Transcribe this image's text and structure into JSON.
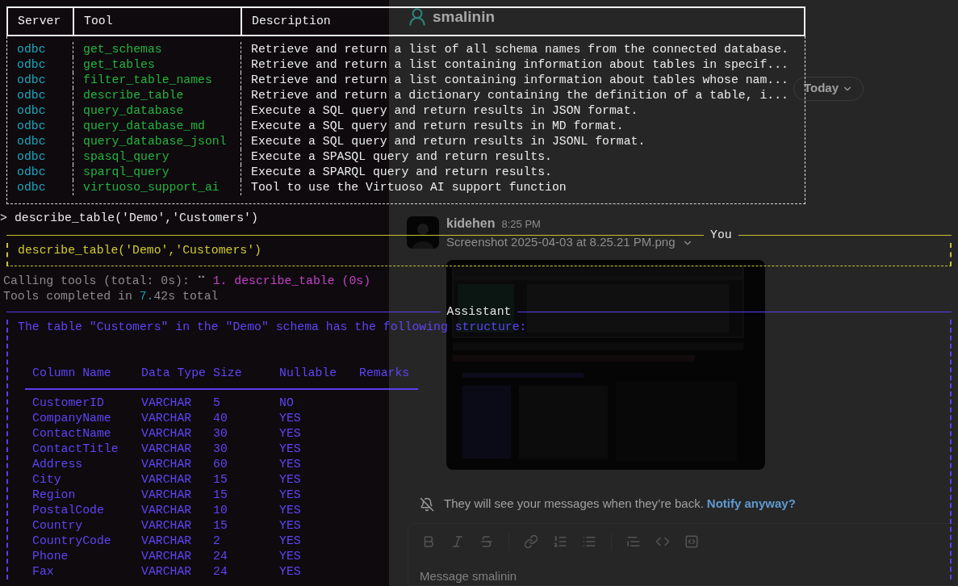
{
  "terminal": {
    "tools_table": {
      "columns": [
        "Server",
        "Tool",
        "Description"
      ],
      "rows": [
        {
          "server": "odbc",
          "tool": "get_schemas",
          "description": "Retrieve and return a list of all schema names from the connected database."
        },
        {
          "server": "odbc",
          "tool": "get_tables",
          "description": "Retrieve and return a list containing information about tables in specif..."
        },
        {
          "server": "odbc",
          "tool": "filter_table_names",
          "description": "Retrieve and return a list containing information about tables whose nam..."
        },
        {
          "server": "odbc",
          "tool": "describe_table",
          "description": "Retrieve and return a dictionary containing the definition of a table, i..."
        },
        {
          "server": "odbc",
          "tool": "query_database",
          "description": "Execute a SQL query and return results in JSON format."
        },
        {
          "server": "odbc",
          "tool": "query_database_md",
          "description": "Execute a SQL query and return results in MD format."
        },
        {
          "server": "odbc",
          "tool": "query_database_jsonl",
          "description": "Execute a SQL query and return results in JSONL format."
        },
        {
          "server": "odbc",
          "tool": "spasql_query",
          "description": "Execute a SPASQL query and return results."
        },
        {
          "server": "odbc",
          "tool": "sparql_query",
          "description": "Execute a SPARQL query and return results."
        },
        {
          "server": "odbc",
          "tool": "virtuoso_support_ai",
          "description": "Tool to use the Virtuoso AI support function"
        }
      ]
    },
    "prompt": {
      "marker": ">",
      "command": "describe_table('Demo','Customers')"
    },
    "user_message": {
      "label": "You",
      "text": "describe_table('Demo','Customers')"
    },
    "status_lines": [
      [
        {
          "text": "Calling tools (total: 0s): ",
          "kind": "plain"
        },
        {
          "text": "⠉ ",
          "kind": "spinner"
        },
        {
          "text": "1. describe_table (0s)",
          "kind": "call"
        }
      ],
      [
        {
          "text": "Tools completed in ",
          "kind": "plain"
        },
        {
          "text": "7.",
          "kind": "accent"
        },
        {
          "text": "42s total",
          "kind": "plain"
        }
      ]
    ],
    "assistant_message": {
      "label": "Assistant",
      "intro": "The table \"Customers\" in the \"Demo\" schema has the following structure:",
      "table": {
        "columns": [
          "Column Name",
          "Data Type",
          "Size",
          "Nullable",
          "Remarks"
        ],
        "rows": [
          [
            "CustomerID",
            "VARCHAR",
            "5",
            "NO"
          ],
          [
            "CompanyName",
            "VARCHAR",
            "40",
            "YES"
          ],
          [
            "ContactName",
            "VARCHAR",
            "30",
            "YES"
          ],
          [
            "ContactTitle",
            "VARCHAR",
            "30",
            "YES"
          ],
          [
            "Address",
            "VARCHAR",
            "60",
            "YES"
          ],
          [
            "City",
            "VARCHAR",
            "15",
            "YES"
          ],
          [
            "Region",
            "VARCHAR",
            "15",
            "YES"
          ],
          [
            "PostalCode",
            "VARCHAR",
            "10",
            "YES"
          ],
          [
            "Country",
            "VARCHAR",
            "15",
            "YES"
          ],
          [
            "CountryCode",
            "VARCHAR",
            "2",
            "YES"
          ],
          [
            "Phone",
            "VARCHAR",
            "24",
            "YES"
          ],
          [
            "Fax",
            "VARCHAR",
            "24",
            "YES"
          ]
        ]
      }
    }
  },
  "chat": {
    "header": {
      "title": "smalinin"
    },
    "date_pill": "Today",
    "message": {
      "author": "kidehen",
      "time": "8:25 PM",
      "attachment": "Screenshot 2025-04-03 at 8.25.21 PM.png"
    },
    "away_notice": {
      "text": "They will see your messages when they’re back.",
      "link": "Notify anyway?"
    },
    "composer": {
      "placeholder": "Message smalinin"
    }
  }
}
